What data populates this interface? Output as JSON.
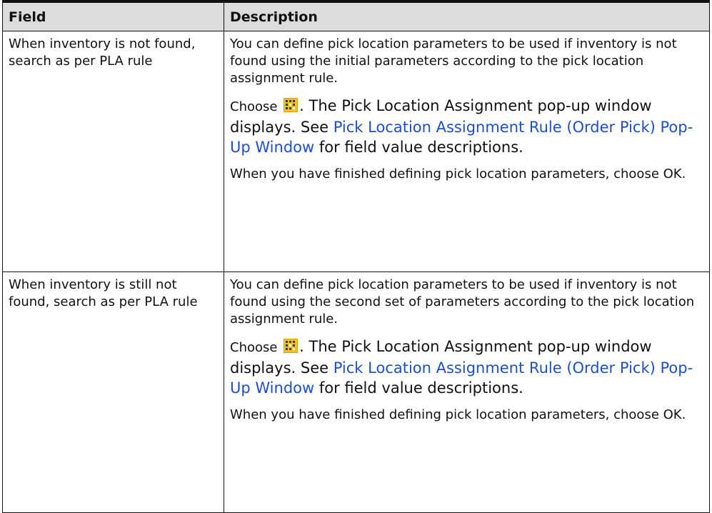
{
  "header": {
    "col_field": "Field",
    "col_description": "Description"
  },
  "rows": [
    {
      "field": "When inventory is not found, search as per PLA rule",
      "desc1": "You can define pick location parameters to be used if inventory is not found using the initial parameters according to the pick location assignment rule.",
      "choose_word": "Choose",
      "icon_name": "search-config-icon",
      "choose_rest": ". The Pick Location Assignment pop-up window displays. See ",
      "link_text": "Pick Location Assignment Rule (Order Pick) Pop-Up Window",
      "after_link": " for field value descriptions.",
      "desc3": "When you have finished defining pick location parameters, choose OK."
    },
    {
      "field": "When inventory is still not found, search as per PLA rule",
      "desc1": "You can define pick location parameters to be used if inventory is not found using the second set of parameters according to the pick location assignment rule.",
      "choose_word": "Choose",
      "icon_name": "search-config-icon",
      "choose_rest": ". The Pick Location Assignment pop-up window displays. See ",
      "link_text": "Pick Location Assignment Rule (Order Pick) Pop-Up Window",
      "after_link": " for field value descriptions.",
      "desc3": "When you have finished defining pick location parameters, choose OK."
    }
  ],
  "colors": {
    "link": "#1b4fcf",
    "header_bg": "#dcdcdc",
    "border": "#111111"
  }
}
